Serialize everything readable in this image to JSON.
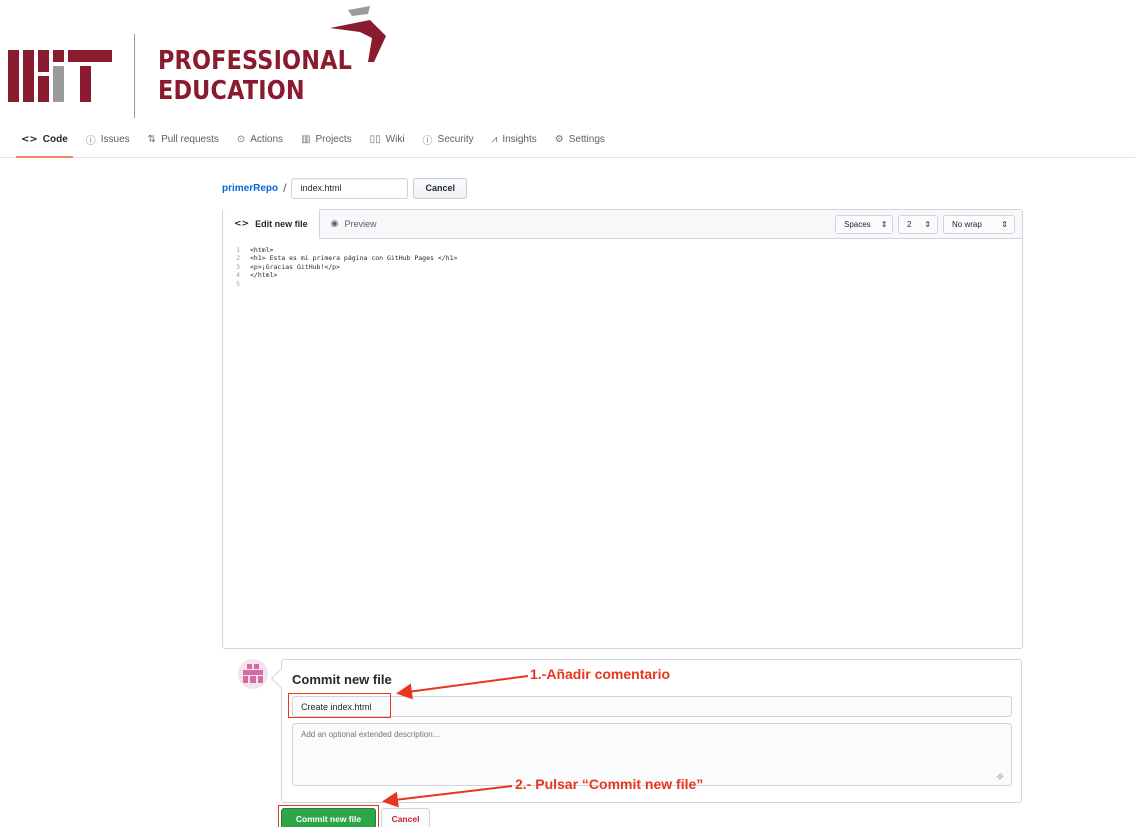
{
  "brand": {
    "logo_text": "MIT",
    "line1": "PROFESSIONAL",
    "line2": "EDUCATION",
    "colors": {
      "red": "#8a1a2e",
      "gray": "#9a9a9a"
    }
  },
  "repo_nav": {
    "tabs": [
      {
        "label": "Code",
        "icon": "code-icon",
        "active": true
      },
      {
        "label": "Issues",
        "icon": "issue-icon",
        "active": false
      },
      {
        "label": "Pull requests",
        "icon": "pull-request-icon",
        "active": false
      },
      {
        "label": "Actions",
        "icon": "play-icon",
        "active": false
      },
      {
        "label": "Projects",
        "icon": "project-icon",
        "active": false
      },
      {
        "label": "Wiki",
        "icon": "book-icon",
        "active": false
      },
      {
        "label": "Security",
        "icon": "shield-icon",
        "active": false
      },
      {
        "label": "Insights",
        "icon": "graph-icon",
        "active": false
      },
      {
        "label": "Settings",
        "icon": "gear-icon",
        "active": false
      }
    ]
  },
  "breadcrumb": {
    "repo": "primerRepo",
    "separator": "/",
    "filename": "index.html",
    "cancel_label": "Cancel"
  },
  "editor": {
    "tabs": [
      {
        "label": "Edit new file",
        "icon": "code-icon",
        "active": true
      },
      {
        "label": "Preview",
        "icon": "eye-icon",
        "active": false
      }
    ],
    "indent_mode": "Spaces",
    "indent_size": "2",
    "wrap_mode": "No wrap",
    "lines": [
      {
        "n": "1",
        "text": "<html>"
      },
      {
        "n": "2",
        "text": "<h1> Esta es mi primera página con GitHub Pages </h1>"
      },
      {
        "n": "3",
        "text": "<p>¡Gracias GitHub!</p>"
      },
      {
        "n": "4",
        "text": "</html>"
      },
      {
        "n": "5",
        "text": ""
      }
    ]
  },
  "commit": {
    "title": "Commit new file",
    "summary_value": "Create index.html",
    "description_placeholder": "Add an optional extended description…",
    "commit_label": "Commit new file",
    "cancel_label": "Cancel"
  },
  "annotations": {
    "step1": "1.-Añadir comentario",
    "step2": "2.- Pulsar “Commit new file”",
    "color": "#e8361e"
  }
}
